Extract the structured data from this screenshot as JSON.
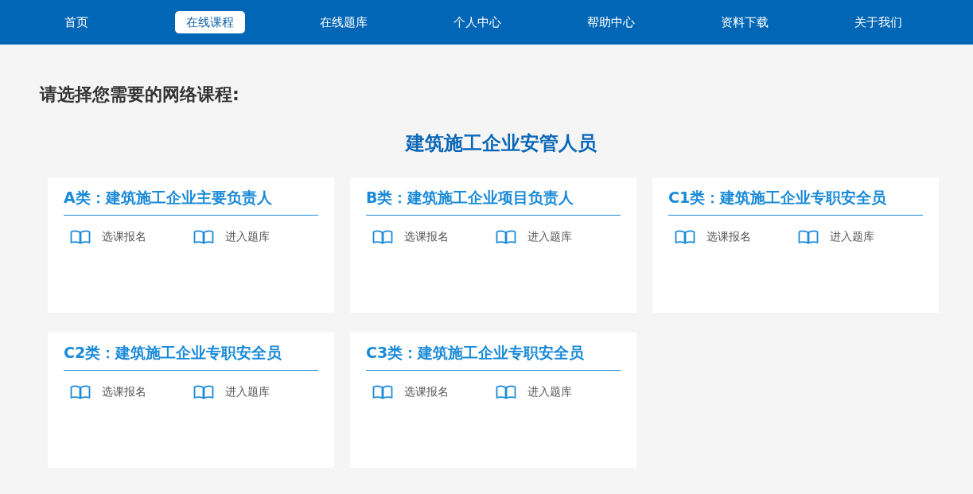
{
  "nav": [
    {
      "label": "首页",
      "selected": false
    },
    {
      "label": "在线课程",
      "selected": true
    },
    {
      "label": "在线题库",
      "selected": false
    },
    {
      "label": "个人中心",
      "selected": false
    },
    {
      "label": "帮助中心",
      "selected": false
    },
    {
      "label": "资料下载",
      "selected": false
    },
    {
      "label": "关于我们",
      "selected": false
    }
  ],
  "heading": "请选择您需要的网络课程:",
  "section_title": "建筑施工企业安管人员",
  "courses": [
    {
      "title": "A类：建筑施工企业主要负责人",
      "links": [
        "选课报名",
        "进入题库"
      ]
    },
    {
      "title": "B类：建筑施工企业项目负责人",
      "links": [
        "选课报名",
        "进入题库"
      ]
    },
    {
      "title": "C1类：建筑施工企业专职安全员",
      "links": [
        "选课报名",
        "进入题库"
      ]
    },
    {
      "title": "C2类：建筑施工企业专职安全员",
      "links": [
        "选课报名",
        "进入题库"
      ]
    },
    {
      "title": "C3类：建筑施工企业专职安全员",
      "links": [
        "选课报名",
        "进入题库"
      ]
    }
  ]
}
